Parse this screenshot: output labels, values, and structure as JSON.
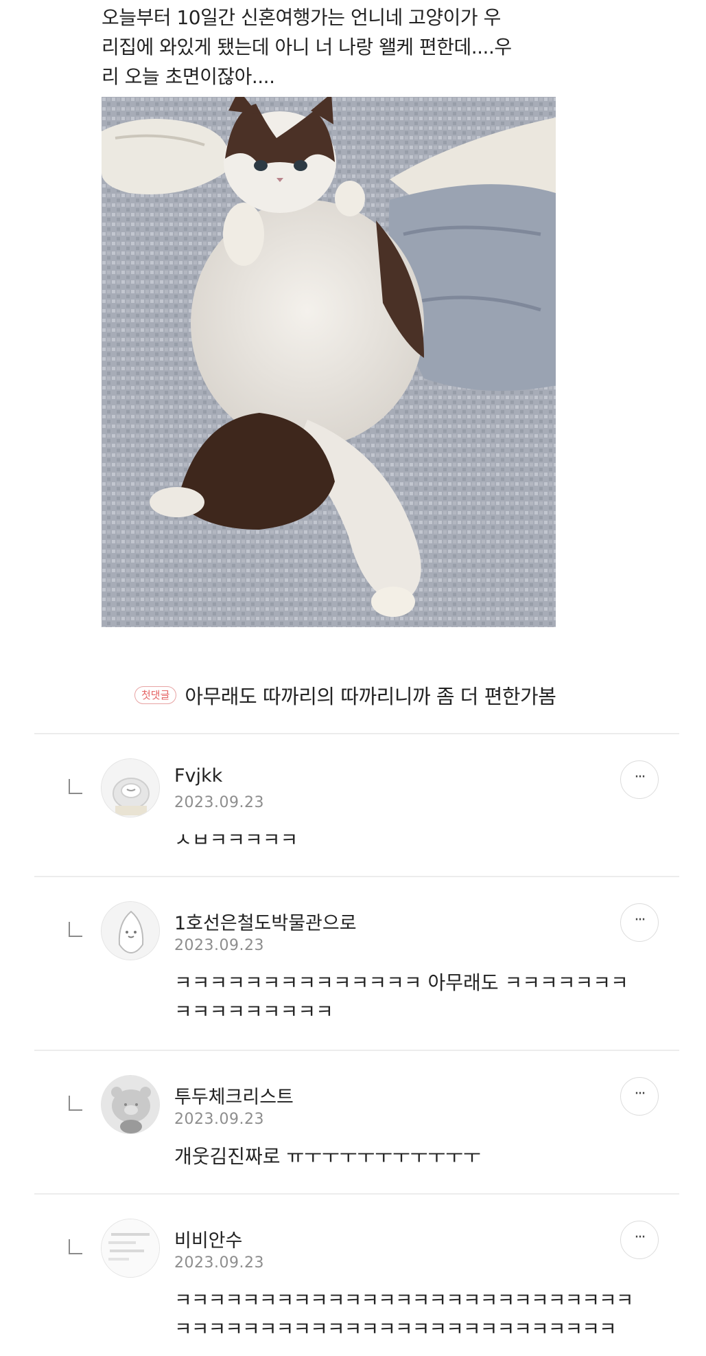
{
  "post": {
    "lines": [
      "오늘부터 10일간 신혼여행가는 언니네 고양이가 우",
      "리집에 와있게 됐는데 아니 너 나랑 왤케 편한데....우",
      "리 오늘 초면이잖아...."
    ]
  },
  "first_comment": {
    "badge": "첫댓글",
    "text": "아무래도 따까리의 따까리니까 좀 더 편한가봄"
  },
  "replies": [
    {
      "username": "Fvjkk",
      "date": "2023.09.23",
      "lines": [
        "ㅅㅂㅋㅋㅋㅋㅋ"
      ],
      "more": "···"
    },
    {
      "username": "1호선은철도박물관으로",
      "date": "2023.09.23",
      "lines": [
        "ㅋㅋㅋㅋㅋㅋㅋㅋㅋㅋㅋㅋㅋㅋ 아무래도 ㅋㅋㅋㅋㅋㅋㅋ",
        "ㅋㅋㅋㅋㅋㅋㅋㅋㅋ"
      ],
      "more": "···"
    },
    {
      "username": "투두체크리스트",
      "date": "2023.09.23",
      "lines": [
        "개웃김진짜로 ㅠㅜㅜㅜㅜㅜㅜㅜㅜㅜㅜ"
      ],
      "more": "···"
    },
    {
      "username": "비비안수",
      "date": "2023.09.23",
      "lines": [
        "ㅋㅋㅋㅋㅋㅋㅋㅋㅋㅋㅋㅋㅋㅋㅋㅋㅋㅋㅋㅋㅋㅋㅋㅋㅋㅋㅋ",
        "ㅋㅋㅋㅋㅋㅋㅋㅋㅋㅋㅋㅋㅋㅋㅋㅋㅋㅋㅋㅋㅋㅋㅋㅋㅋㅋ"
      ],
      "more": "···"
    }
  ]
}
